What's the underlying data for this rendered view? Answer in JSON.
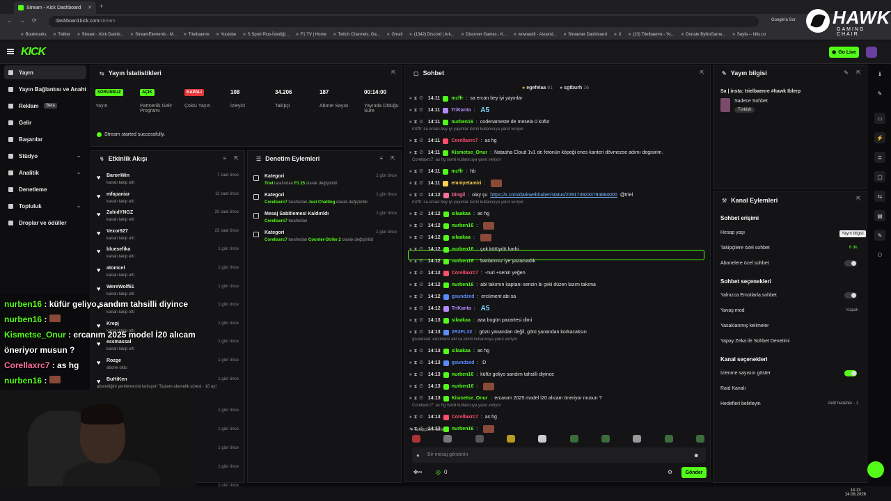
{
  "browser": {
    "tab_title": "Stream - Kick Dashboard",
    "url_host": "dashboard.kick.com",
    "url_path": "/stream",
    "bookmarks": [
      "Bookmarks",
      "Twitter",
      "Stream - Kick Dashb...",
      "StreamElements - M...",
      "Trielbaenre",
      "Youtube",
      "S Sport Plus-İstediği...",
      "F1 TV | Home",
      "Twitch Channels, Ga...",
      "Gmail",
      "(1342) Discord | Ark...",
      "Discover Games - K...",
      "wowaudit - Ascend...",
      "Streamer Dashboard",
      "X",
      "(23) Trielbaenre - Yo...",
      "Donate ByNoGame...",
      "Sayfa -- hiits.co"
    ],
    "google_btn": "Google'a Sor"
  },
  "overlay_brand": {
    "name": "HAWK",
    "sub": "GAMING CHAIR"
  },
  "header": {
    "logo": "KICK",
    "go_live": "Go Live"
  },
  "sidebar": {
    "items": [
      {
        "label": "Yayın"
      },
      {
        "label": "Yayın Bağlantısı ve Anahtarı"
      },
      {
        "label": "Reklam",
        "badge": "Beta"
      },
      {
        "label": "Gelir"
      },
      {
        "label": "Başarılar"
      },
      {
        "label": "Stüdyo"
      },
      {
        "label": "Analitik"
      },
      {
        "label": "Denetleme"
      },
      {
        "label": "Topluluk"
      },
      {
        "label": "Droplar ve ödüller"
      }
    ]
  },
  "stats": {
    "title": "Yayın İstatistikleri",
    "cells": [
      {
        "pill": "SORUNSUZ",
        "label": "Yayın"
      },
      {
        "pill": "AÇIK",
        "label": "Partnerlik Gelir Programı"
      },
      {
        "pill": "KAPALI",
        "label": "Çoklu Yayın"
      },
      {
        "value": "108",
        "label": "İzleyici"
      },
      {
        "value": "34.206",
        "label": "Takipçi"
      },
      {
        "value": "187",
        "label": "Abone Sayısı"
      },
      {
        "value": "00:14:00",
        "label": "Yayında Olduğu Süre"
      }
    ],
    "success": "Stream started successfully."
  },
  "activity": {
    "title": "Etkinlik Akışı",
    "rows": [
      {
        "name": "BaronWin",
        "sub": "kanalı takip etti",
        "time": "7 saat önce"
      },
      {
        "name": "mfapaniar",
        "sub": "kanalı takip etti",
        "time": "11 saat önce"
      },
      {
        "name": "ZahidYNGZ",
        "sub": "kanalı takip etti",
        "time": "20 saat önce"
      },
      {
        "name": "Vexor927",
        "sub": "kanalı takip etti",
        "time": "23 saat önce"
      },
      {
        "name": "bluesefika",
        "sub": "kanalı takip etti",
        "time": "1 gün önce"
      },
      {
        "name": "atomcel",
        "sub": "kanalı takip etti",
        "time": "1 gün önce"
      },
      {
        "name": "WereWolf61",
        "sub": "kanalı takip etti",
        "time": "1 gün önce"
      },
      {
        "name": "yamdz.22",
        "sub": "kanalı takip etti",
        "time": "1 gün önce"
      },
      {
        "name": "Krepj",
        "sub": "kanalı takip etti",
        "time": "1 gün önce"
      },
      {
        "name": "essmassal",
        "sub": "kanalı takip etti",
        "time": "1 gün önce"
      },
      {
        "name": "Rozge",
        "sub": "abone oldu",
        "time": "1 gün önce"
      },
      {
        "name": "BuHiKen",
        "sub": "aboneliğini yenilemesini kutluyor! Toplam abonelik süresi - 10 ay!",
        "time": "1 gün önce"
      }
    ],
    "extra_times": [
      "1 gün önce",
      "1 gün önce",
      "1 gün önce",
      "1 gün önce",
      "1 gün önce"
    ]
  },
  "moderation": {
    "title": "Denetim Eylemleri",
    "rows": [
      {
        "title": "Kategori",
        "who": "Triel",
        "mid": " tarafından ",
        "what": "F1 25",
        "end": " olarak değiştirildi",
        "time": "1 gün önce"
      },
      {
        "title": "Kategori",
        "who": "Corellaxrc7",
        "mid": " tarafından ",
        "what": "Just Chatting",
        "end": " olarak değiştirildi",
        "time": "1 gün önce"
      },
      {
        "title": "Mesaj Sabitlemesi Kaldırıldı",
        "who": "Corellaxrc7",
        "mid": " tarafından",
        "what": "",
        "end": "",
        "time": "1 gün önce"
      },
      {
        "title": "Kategori",
        "who": "Corellaxrc7",
        "mid": " tarafından ",
        "what": "Counter-Strike 2",
        "end": " olarak değiştirildi",
        "time": "1 gün önce"
      }
    ]
  },
  "chat": {
    "title": "Sohbet",
    "top_users": [
      {
        "name": "egefelaa",
        "count": "91"
      },
      {
        "name": "sgtburh",
        "count": "16"
      }
    ],
    "messages": [
      {
        "time": "14:11",
        "user": "mzffr",
        "color": "#53fc18",
        "text": "sa ercan bey iyi yayınlar"
      },
      {
        "time": "14:11",
        "user": "TriKanta",
        "color": "#b68cff",
        "text": "",
        "emote": "A5"
      },
      {
        "time": "14:11",
        "user": "nurben16",
        "color": "#53fc18",
        "text": "codenameste de mesela 0 küfür"
      },
      {
        "reply": "mzffr: sa ercan bey iyi yayınlar isimli kullanıcıya yanıt veriyor"
      },
      {
        "time": "14:11",
        "user": "Corellaxrc7",
        "color": "#ff4d6d",
        "text": "as hg"
      },
      {
        "time": "14:11",
        "user": "Kismetse_Onur",
        "color": "#53fc18",
        "text": "Natasha Cloud 1v1 de fetonün köpeği enes kanteri dövmezse adımı degisirim."
      },
      {
        "reply": "Corellaxrc7: as hg isimli kullanıcıya yanıt veriyor"
      },
      {
        "time": "14:11",
        "user": "mzffr",
        "color": "#53fc18",
        "text": "hb"
      },
      {
        "time": "14:11",
        "user": "emniyetamiri",
        "color": "#ffd24d",
        "text": "",
        "img": true
      },
      {
        "time": "14:12",
        "user": "Dingil",
        "color": "#ff6f9c",
        "text": "olay şu ",
        "link": "https://x.com/darkwebhaber/status/2091739233794884000",
        "tail": " @triel"
      },
      {
        "reply": "mzffr: sa ercan bey iyi yayınlar isimli kullanıcıya yanıt veriyor"
      },
      {
        "time": "14:12",
        "user": "silaakaa",
        "color": "#53fc18",
        "text": "as hg"
      },
      {
        "time": "14:12",
        "user": "nurben16",
        "color": "#53fc18",
        "text": "",
        "img": true
      },
      {
        "time": "14:12",
        "user": "silaakaa",
        "color": "#53fc18",
        "text": "",
        "img": true
      },
      {
        "time": "14:12",
        "user": "nurben16",
        "color": "#53fc18",
        "text": "çok kötüydü harbi"
      },
      {
        "time": "14:12",
        "user": "nurben16",
        "color": "#53fc18",
        "text": "banlanınız iye yazamadık"
      },
      {
        "time": "14:12",
        "user": "Corellaxrc7",
        "color": "#ff4d6d",
        "text": "-nuri +senin yeğen"
      },
      {
        "time": "14:12",
        "user": "nurben16",
        "color": "#53fc18",
        "text": "abi takımın kaptanı sensin bi çeki düzen lazım takıma"
      },
      {
        "time": "14:12",
        "user": "gsundzed",
        "color": "#5a8cff",
        "text": "ercüment abi sa"
      },
      {
        "time": "14:12",
        "user": "TriKanta",
        "color": "#b68cff",
        "text": "",
        "emote": "A5"
      },
      {
        "time": "14:13",
        "user": "silaakaa",
        "color": "#53fc18",
        "text": "aaa bugün pazartesi dimi"
      },
      {
        "time": "14:13",
        "user": "2R3FL3X",
        "color": "#5a8cff",
        "text": "gözü yanandan değil, götü yanandan korkacaksın"
      },
      {
        "reply": "gsundzed: ercüment abi sa isimli kullanıcıya yanıt veriyor"
      },
      {
        "time": "14:13",
        "user": "silaakaa",
        "color": "#53fc18",
        "text": "as hg"
      },
      {
        "time": "14:13",
        "user": "gsundzed",
        "color": "#5a8cff",
        "text": ":D"
      },
      {
        "time": "14:13",
        "user": "nurben16",
        "color": "#53fc18",
        "text": "küfür geliyo sandım tahsilli diyince"
      },
      {
        "time": "14:13",
        "user": "nurben16",
        "color": "#53fc18",
        "text": "",
        "img": true
      },
      {
        "time": "14:13",
        "user": "Kismetse_Onur",
        "color": "#53fc18",
        "text": "ercanım 2025 model İ20 alıcam öneriyor musun ?"
      },
      {
        "reply": "Corellaxrc7: as hg isimli kullanıcıya yanıt veriyor"
      },
      {
        "time": "14:13",
        "user": "Corellaxrc7",
        "color": "#ff4d6d",
        "text": "as hg"
      },
      {
        "time": "14:13",
        "user": "nurben16",
        "color": "#53fc18",
        "text": "",
        "img": true
      }
    ],
    "followers_only": "Takipçilere Özel",
    "input_placeholder": "Bir mesaj gönderin",
    "points": "0",
    "send": "Gönder"
  },
  "stream_info": {
    "title": "Yayın bilgisi",
    "stream_title": "Sa | insta: trielbaenre #hawk Iblerp",
    "category": "Sadece Sohbet",
    "tag": "Turkish"
  },
  "channel_actions": {
    "title": "Kanal Eylemleri",
    "chat_access": "Sohbet erişimi",
    "account_age": "Hesap yaşı",
    "followers_chat": "Takipçilere özel sohbet",
    "followers_val": "6 dk.",
    "subs_chat": "Abonelere özel sohbet",
    "chat_options": "Sohbet seçenekleri",
    "emote_only": "Yalnızca Emotlarla sohbet",
    "slow_mode": "Yavaş mod",
    "slow_val": "Kapalı",
    "banned_words": "Yasaklanmış kelimeler",
    "ai_mod": "Yapay Zeka ile Sohbet Denetimi",
    "channel_options": "Kanal seçenekleri",
    "show_viewers": "İzlenme sayısını göster",
    "raid": "Raid Kanalı",
    "goals": "Hedefleri belirleyin",
    "goals_val": "Aktif hedefler - 1",
    "tooltip": "Yayın bilgisi"
  },
  "overlay_chat": [
    {
      "user": "nurben16",
      "text": "küfür geliyo sandım tahsilli diyince"
    },
    {
      "user": "nurben16",
      "text": ""
    },
    {
      "user": "Kismetse_Onur",
      "text": "ercanım 2025 model İ20 alıcam"
    },
    {
      "user": "",
      "text": "öneriyor musun ?"
    },
    {
      "user": "Corellaxrc7",
      "text": "as hg"
    },
    {
      "user": "nurben16",
      "text": ""
    }
  ],
  "taskbar": {
    "time": "14:13",
    "date": "24.08.2026"
  }
}
